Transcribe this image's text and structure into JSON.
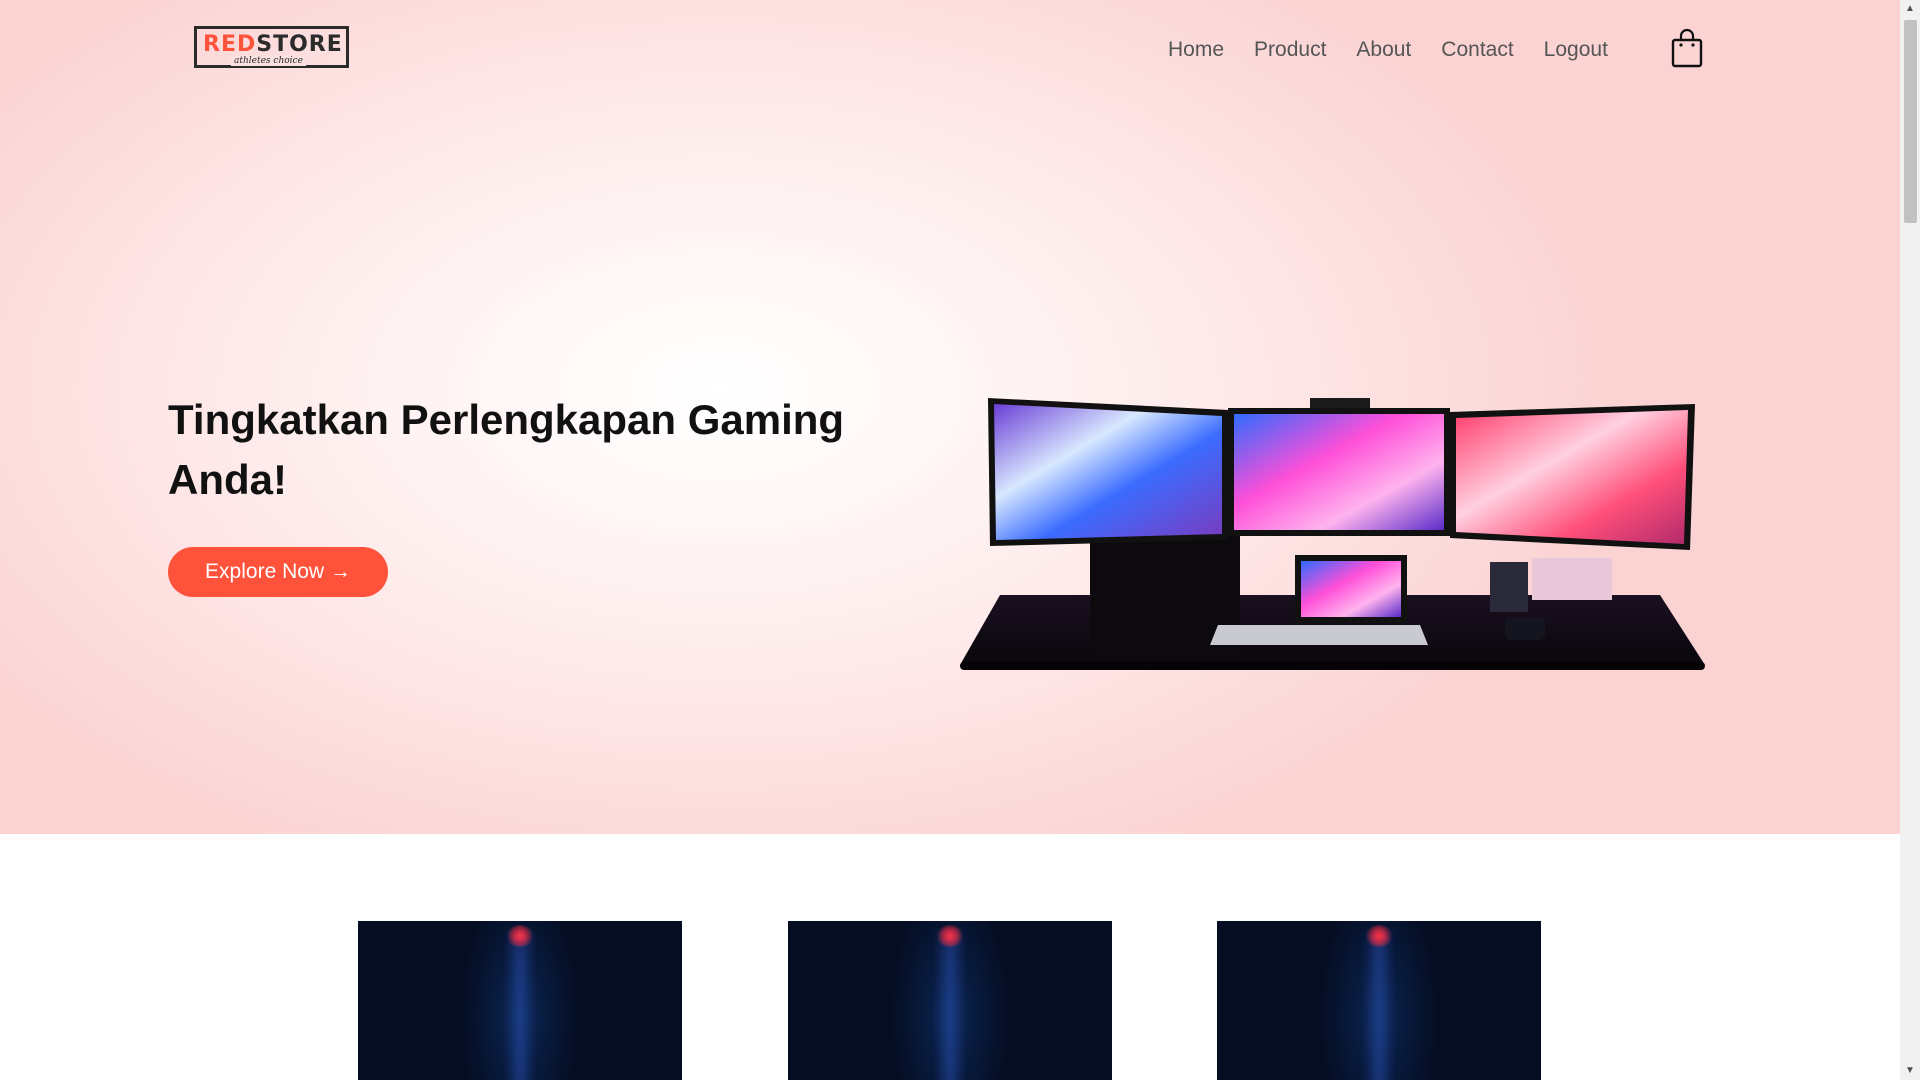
{
  "header": {
    "logo": {
      "brand_part1": "RED",
      "brand_part2": "STORE",
      "tagline": "athletes choice"
    },
    "nav": [
      {
        "label": "Home"
      },
      {
        "label": "Product"
      },
      {
        "label": "About"
      },
      {
        "label": "Contact"
      },
      {
        "label": "Logout"
      }
    ],
    "cart_icon": "shopping-bag-icon"
  },
  "hero": {
    "title": "Tingkatkan Perlengkapan Gaming Anda!",
    "cta_label": "Explore Now →",
    "image_desc_icon": "gaming-setup-image"
  },
  "categories": {
    "items": [
      {
        "icon": "category-image"
      },
      {
        "icon": "category-image"
      },
      {
        "icon": "category-image"
      }
    ]
  },
  "colors": {
    "accent": "#ff523b",
    "hero_bg": "#fbd3d3",
    "text_dark": "#111111",
    "nav_text": "#555555"
  }
}
